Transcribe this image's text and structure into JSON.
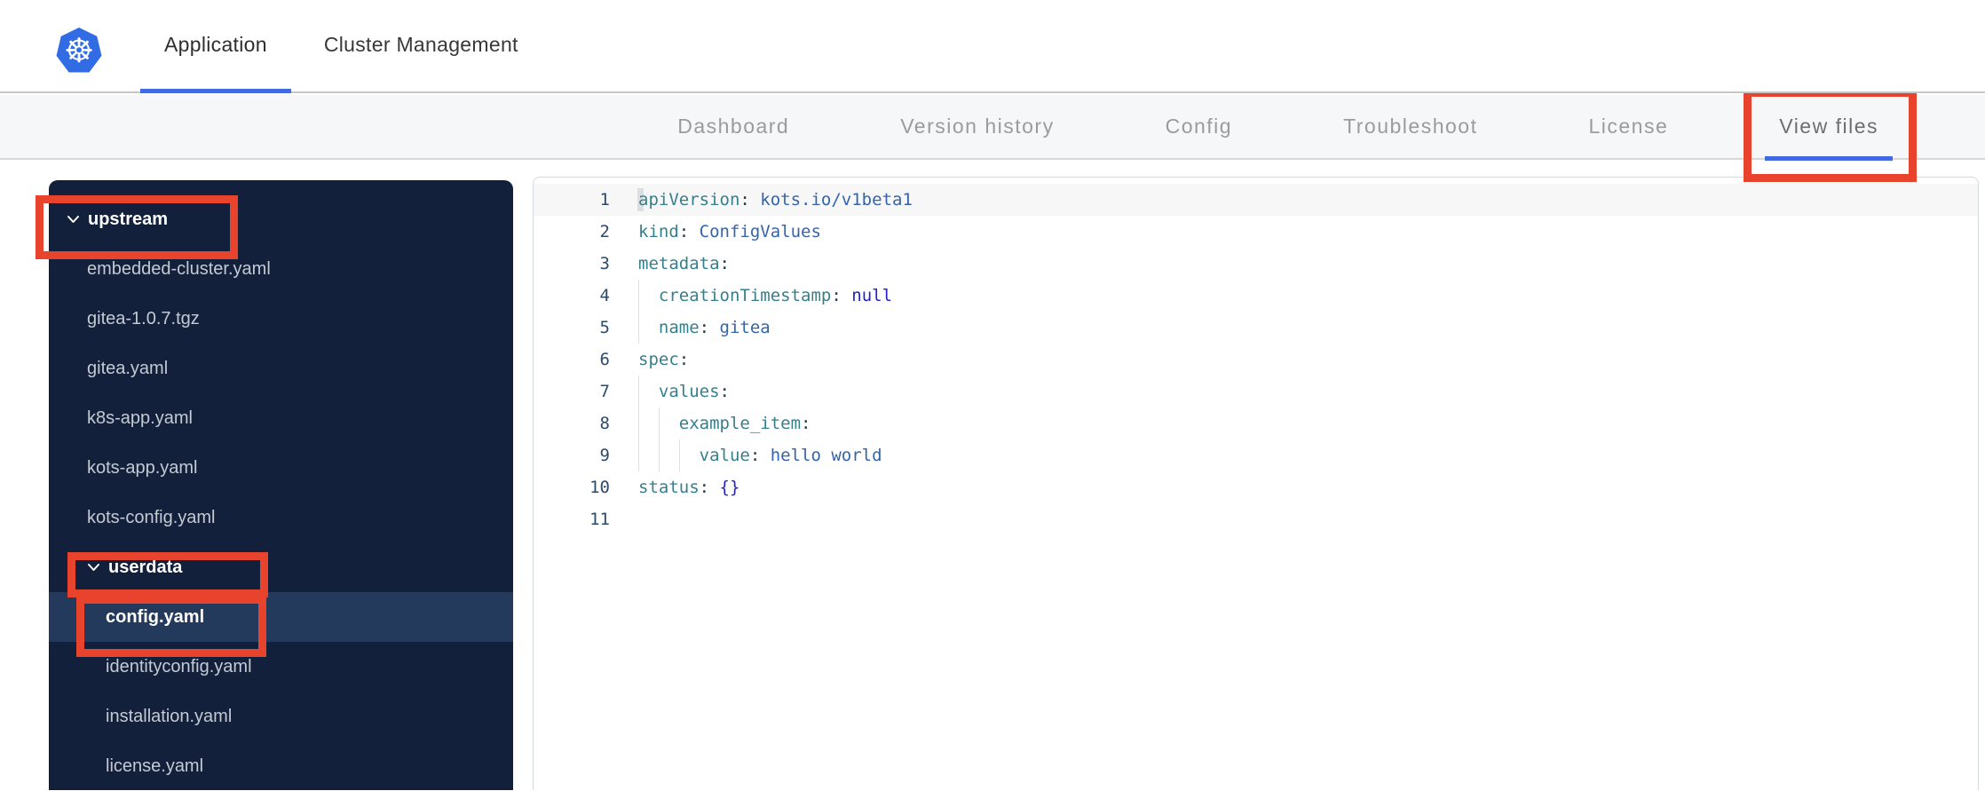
{
  "header": {
    "logo": "kubernetes-logo",
    "logo_glyph": "☸",
    "tabs": [
      {
        "label": "Application",
        "active": true
      },
      {
        "label": "Cluster Management",
        "active": false
      }
    ]
  },
  "subnav": {
    "tabs": [
      {
        "label": "Dashboard",
        "active": false,
        "annotated": false
      },
      {
        "label": "Version history",
        "active": false,
        "annotated": false
      },
      {
        "label": "Config",
        "active": false,
        "annotated": false
      },
      {
        "label": "Troubleshoot",
        "active": false,
        "annotated": false
      },
      {
        "label": "License",
        "active": false,
        "annotated": false
      },
      {
        "label": "View files",
        "active": true,
        "annotated": true
      }
    ]
  },
  "file_tree": {
    "items": [
      {
        "label": "upstream",
        "type": "folder",
        "expanded": true,
        "level": 0,
        "selected": false,
        "annotated": true,
        "ann_class": "ann-upstream"
      },
      {
        "label": "embedded-cluster.yaml",
        "type": "file",
        "level": 1,
        "selected": false,
        "annotated": false
      },
      {
        "label": "gitea-1.0.7.tgz",
        "type": "file",
        "level": 1,
        "selected": false,
        "annotated": false
      },
      {
        "label": "gitea.yaml",
        "type": "file",
        "level": 1,
        "selected": false,
        "annotated": false
      },
      {
        "label": "k8s-app.yaml",
        "type": "file",
        "level": 1,
        "selected": false,
        "annotated": false
      },
      {
        "label": "kots-app.yaml",
        "type": "file",
        "level": 1,
        "selected": false,
        "annotated": false
      },
      {
        "label": "kots-config.yaml",
        "type": "file",
        "level": 1,
        "selected": false,
        "annotated": false
      },
      {
        "label": "userdata",
        "type": "folder",
        "expanded": true,
        "level": 1,
        "selected": false,
        "annotated": true,
        "ann_class": "ann-userdata"
      },
      {
        "label": "config.yaml",
        "type": "file",
        "level": 2,
        "selected": true,
        "annotated": true,
        "ann_class": "ann-configyaml"
      },
      {
        "label": "identityconfig.yaml",
        "type": "file",
        "level": 2,
        "selected": false,
        "annotated": false
      },
      {
        "label": "installation.yaml",
        "type": "file",
        "level": 2,
        "selected": false,
        "annotated": false
      },
      {
        "label": "license.yaml",
        "type": "file",
        "level": 2,
        "selected": false,
        "annotated": false
      }
    ]
  },
  "editor": {
    "language": "yaml",
    "lines": [
      {
        "n": 1,
        "indent": 0,
        "key": "apiVersion",
        "value": "kots.io/v1beta1",
        "vtype": "string",
        "active": true
      },
      {
        "n": 2,
        "indent": 0,
        "key": "kind",
        "value": "ConfigValues",
        "vtype": "string",
        "active": false
      },
      {
        "n": 3,
        "indent": 0,
        "key": "metadata",
        "value": "",
        "vtype": "none",
        "active": false
      },
      {
        "n": 4,
        "indent": 1,
        "key": "creationTimestamp",
        "value": "null",
        "vtype": "constant",
        "active": false
      },
      {
        "n": 5,
        "indent": 1,
        "key": "name",
        "value": "gitea",
        "vtype": "string",
        "active": false
      },
      {
        "n": 6,
        "indent": 0,
        "key": "spec",
        "value": "",
        "vtype": "none",
        "active": false
      },
      {
        "n": 7,
        "indent": 1,
        "key": "values",
        "value": "",
        "vtype": "none",
        "active": false
      },
      {
        "n": 8,
        "indent": 2,
        "key": "example_item",
        "value": "",
        "vtype": "none",
        "active": false
      },
      {
        "n": 9,
        "indent": 3,
        "key": "value",
        "value": "hello world",
        "vtype": "string",
        "active": false
      },
      {
        "n": 10,
        "indent": 0,
        "key": "status",
        "value": "{}",
        "vtype": "constant",
        "active": false
      },
      {
        "n": 11,
        "indent": 0,
        "key": "",
        "value": "",
        "vtype": "none",
        "active": false
      }
    ]
  },
  "colors": {
    "annotation_red": "#e8432c",
    "active_tab_blue": "#4169e1",
    "k8s_blue": "#326ce5",
    "sidebar_bg": "#13203b",
    "sidebar_selected_bg": "#233a5c",
    "yaml_key": "#35808d",
    "yaml_string": "#3464ad",
    "yaml_constant": "#2323cc"
  }
}
